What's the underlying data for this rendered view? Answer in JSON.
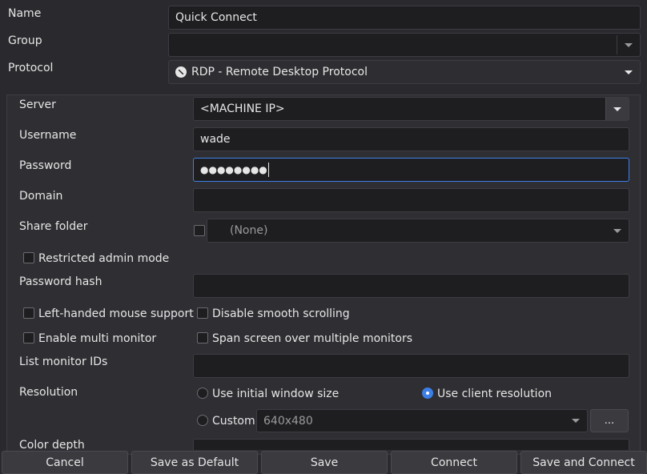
{
  "top": {
    "name_label": "Name",
    "name_value": "Quick Connect",
    "group_label": "Group",
    "group_value": "",
    "protocol_label": "Protocol",
    "protocol_value": "RDP - Remote Desktop Protocol",
    "protocol_icon": "rdp-icon"
  },
  "form": {
    "server_label": "Server",
    "server_value": "<MACHINE IP>",
    "username_label": "Username",
    "username_value": "wade",
    "password_label": "Password",
    "password_value": "●●●●●●●●",
    "domain_label": "Domain",
    "domain_value": "",
    "share_folder_label": "Share folder",
    "share_folder_value": "(None)",
    "restricted_admin_label": "Restricted admin mode",
    "password_hash_label": "Password hash",
    "password_hash_value": "",
    "left_handed_label": "Left-handed mouse support",
    "disable_smooth_label": "Disable smooth scrolling",
    "multi_monitor_label": "Enable multi monitor",
    "span_screen_label": "Span screen over multiple monitors",
    "list_monitor_label": "List monitor IDs",
    "list_monitor_value": "",
    "resolution_label": "Resolution",
    "res_initial_label": "Use initial window size",
    "res_client_label": "Use client resolution",
    "res_custom_label": "Custom",
    "res_custom_value": "640x480",
    "res_custom_button": "...",
    "color_depth_label": "Color depth"
  },
  "buttons": {
    "cancel": "Cancel",
    "save_default": "Save as Default",
    "save": "Save",
    "connect": "Connect",
    "save_connect": "Save and Connect"
  },
  "colors": {
    "background": "#2a2a2e",
    "field": "#1e1e21",
    "accent": "#3d7fe6"
  }
}
